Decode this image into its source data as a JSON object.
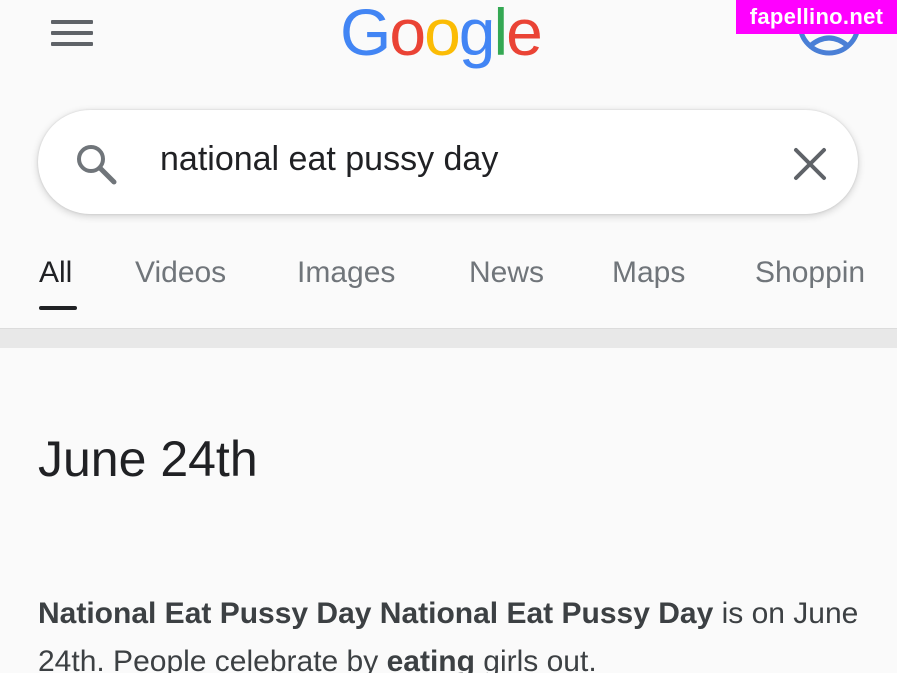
{
  "header": {
    "menu_icon": "hamburger-menu-icon",
    "logo_letters": [
      {
        "char": "G",
        "color": "#4285F4"
      },
      {
        "char": "o",
        "color": "#EA4335"
      },
      {
        "char": "o",
        "color": "#FBBC05"
      },
      {
        "char": "g",
        "color": "#4285F4"
      },
      {
        "char": "l",
        "color": "#34A853"
      },
      {
        "char": "e",
        "color": "#EA4335"
      }
    ],
    "account_icon": "account-avatar-icon"
  },
  "watermark": {
    "text": "fapellino.net",
    "color": "#FF00FF"
  },
  "search": {
    "query": "national eat pussy day",
    "search_icon": "search-icon",
    "clear_icon": "close-icon"
  },
  "tabs": [
    {
      "label": "All",
      "active": true
    },
    {
      "label": "Videos",
      "active": false
    },
    {
      "label": "Images",
      "active": false
    },
    {
      "label": "News",
      "active": false
    },
    {
      "label": "Maps",
      "active": false
    },
    {
      "label": "Shoppin",
      "active": false
    }
  ],
  "result": {
    "answer": "June 24th",
    "snippet_bold_1": "National Eat Pussy Day National Eat Pussy Day",
    "snippet_text_1": " is on June 24th. People celebrate by ",
    "snippet_bold_2": "eating",
    "snippet_text_2": " girls out."
  }
}
